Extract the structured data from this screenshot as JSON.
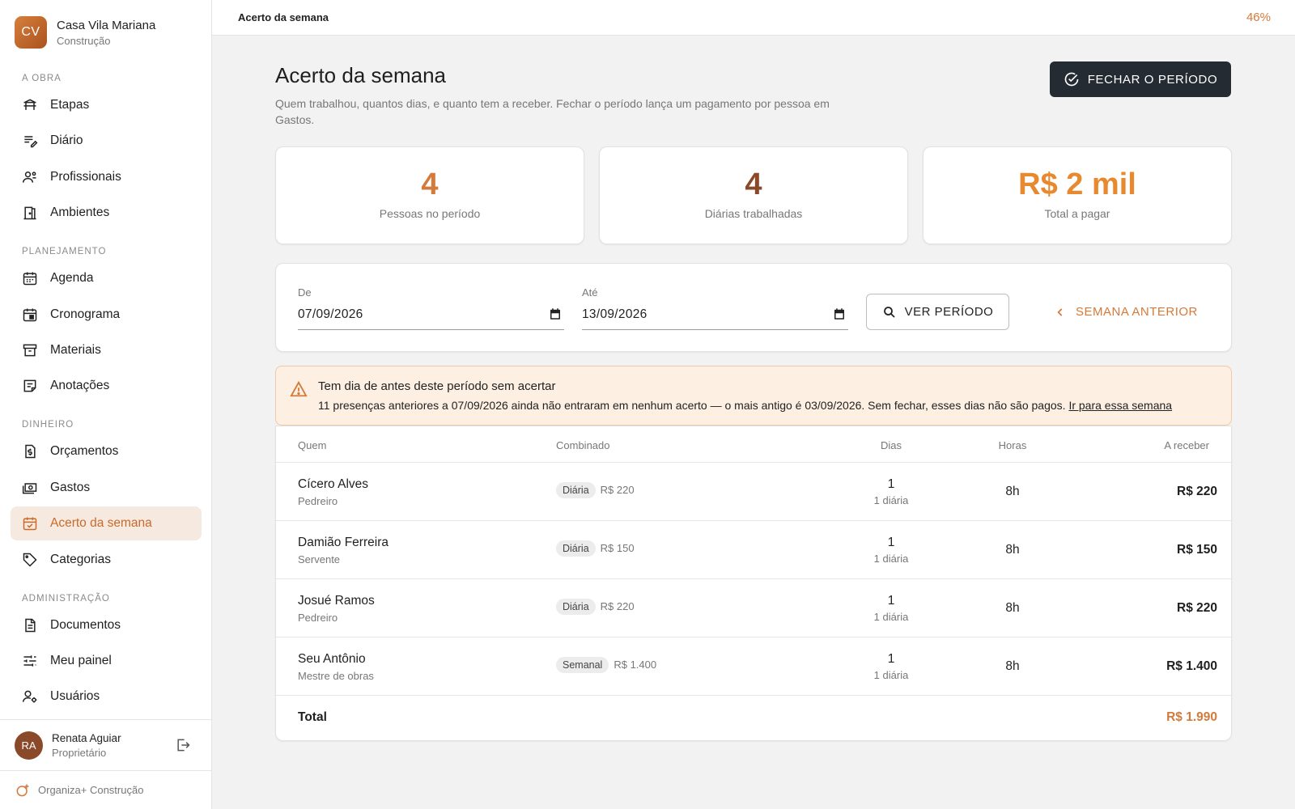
{
  "brand": {
    "initials": "CV",
    "name": "Casa Vila Mariana",
    "subtitle": "Construção"
  },
  "nav": {
    "sections": [
      {
        "title": "A OBRA",
        "items": [
          {
            "label": "Etapas",
            "icon": "site-icon"
          },
          {
            "label": "Diário",
            "icon": "diary-icon"
          },
          {
            "label": "Profissionais",
            "icon": "workers-icon"
          },
          {
            "label": "Ambientes",
            "icon": "door-icon"
          }
        ]
      },
      {
        "title": "PLANEJAMENTO",
        "items": [
          {
            "label": "Agenda",
            "icon": "calendar-icon"
          },
          {
            "label": "Cronograma",
            "icon": "calendar-event-icon"
          },
          {
            "label": "Materiais",
            "icon": "archive-icon"
          },
          {
            "label": "Anotações",
            "icon": "note-icon"
          }
        ]
      },
      {
        "title": "DINHEIRO",
        "items": [
          {
            "label": "Orçamentos",
            "icon": "budget-icon"
          },
          {
            "label": "Gastos",
            "icon": "cash-icon"
          },
          {
            "label": "Acerto da semana",
            "icon": "calendar-check-icon",
            "active": true
          },
          {
            "label": "Categorias",
            "icon": "tag-icon"
          }
        ]
      },
      {
        "title": "ADMINISTRAÇÃO",
        "items": [
          {
            "label": "Documentos",
            "icon": "document-icon"
          },
          {
            "label": "Meu painel",
            "icon": "sliders-icon"
          },
          {
            "label": "Usuários",
            "icon": "user-settings-icon"
          }
        ]
      }
    ]
  },
  "user": {
    "initials": "RA",
    "name": "Renata Aguiar",
    "role": "Proprietário"
  },
  "footer": {
    "label": "Organiza+ Construção"
  },
  "topbar": {
    "title": "Acerto da semana",
    "percent": "46%"
  },
  "page": {
    "title": "Acerto da semana",
    "description": "Quem trabalhou, quantos dias, e quanto tem a receber. Fechar o período lança um pagamento por pessoa em Gastos.",
    "close_button": "FECHAR O PERÍODO"
  },
  "stats": [
    {
      "value": "4",
      "label": "Pessoas no período",
      "color": "#d47a3a"
    },
    {
      "value": "4",
      "label": "Diárias trabalhadas",
      "color": "#8a4a2a"
    },
    {
      "value": "R$ 2 mil",
      "label": "Total a pagar",
      "color": "#e8892f"
    }
  ],
  "filter": {
    "from_label": "De",
    "from_value": "07/09/2026",
    "to_label": "Até",
    "to_value": "13/09/2026",
    "view_button": "VER PERÍODO",
    "prev_button": "SEMANA ANTERIOR"
  },
  "alert": {
    "title": "Tem dia de antes deste período sem acertar",
    "body": "11 presenças anteriores a 07/09/2026 ainda não entraram em nenhum acerto — o mais antigo é 03/09/2026. Sem fechar, esses dias não são pagos. ",
    "link": "Ir para essa semana"
  },
  "table": {
    "headers": {
      "who": "Quem",
      "deal": "Combinado",
      "days": "Dias",
      "hours": "Horas",
      "amount": "A receber"
    },
    "rows": [
      {
        "name": "Cícero Alves",
        "role": "Pedreiro",
        "type": "Diária",
        "rate": "R$ 220",
        "days": "1",
        "days_sub": "1 diária",
        "hours": "8h",
        "amount": "R$ 220"
      },
      {
        "name": "Damião Ferreira",
        "role": "Servente",
        "type": "Diária",
        "rate": "R$ 150",
        "days": "1",
        "days_sub": "1 diária",
        "hours": "8h",
        "amount": "R$ 150"
      },
      {
        "name": "Josué Ramos",
        "role": "Pedreiro",
        "type": "Diária",
        "rate": "R$ 220",
        "days": "1",
        "days_sub": "1 diária",
        "hours": "8h",
        "amount": "R$ 220"
      },
      {
        "name": "Seu Antônio",
        "role": "Mestre de obras",
        "type": "Semanal",
        "rate": "R$ 1.400",
        "days": "1",
        "days_sub": "1 diária",
        "hours": "8h",
        "amount": "R$ 1.400"
      }
    ],
    "total_label": "Total",
    "total_value": "R$ 1.990"
  },
  "colors": {
    "accent": "#d47a3a",
    "dark_button": "#252b33",
    "alert_bg": "#fdf0e3"
  }
}
